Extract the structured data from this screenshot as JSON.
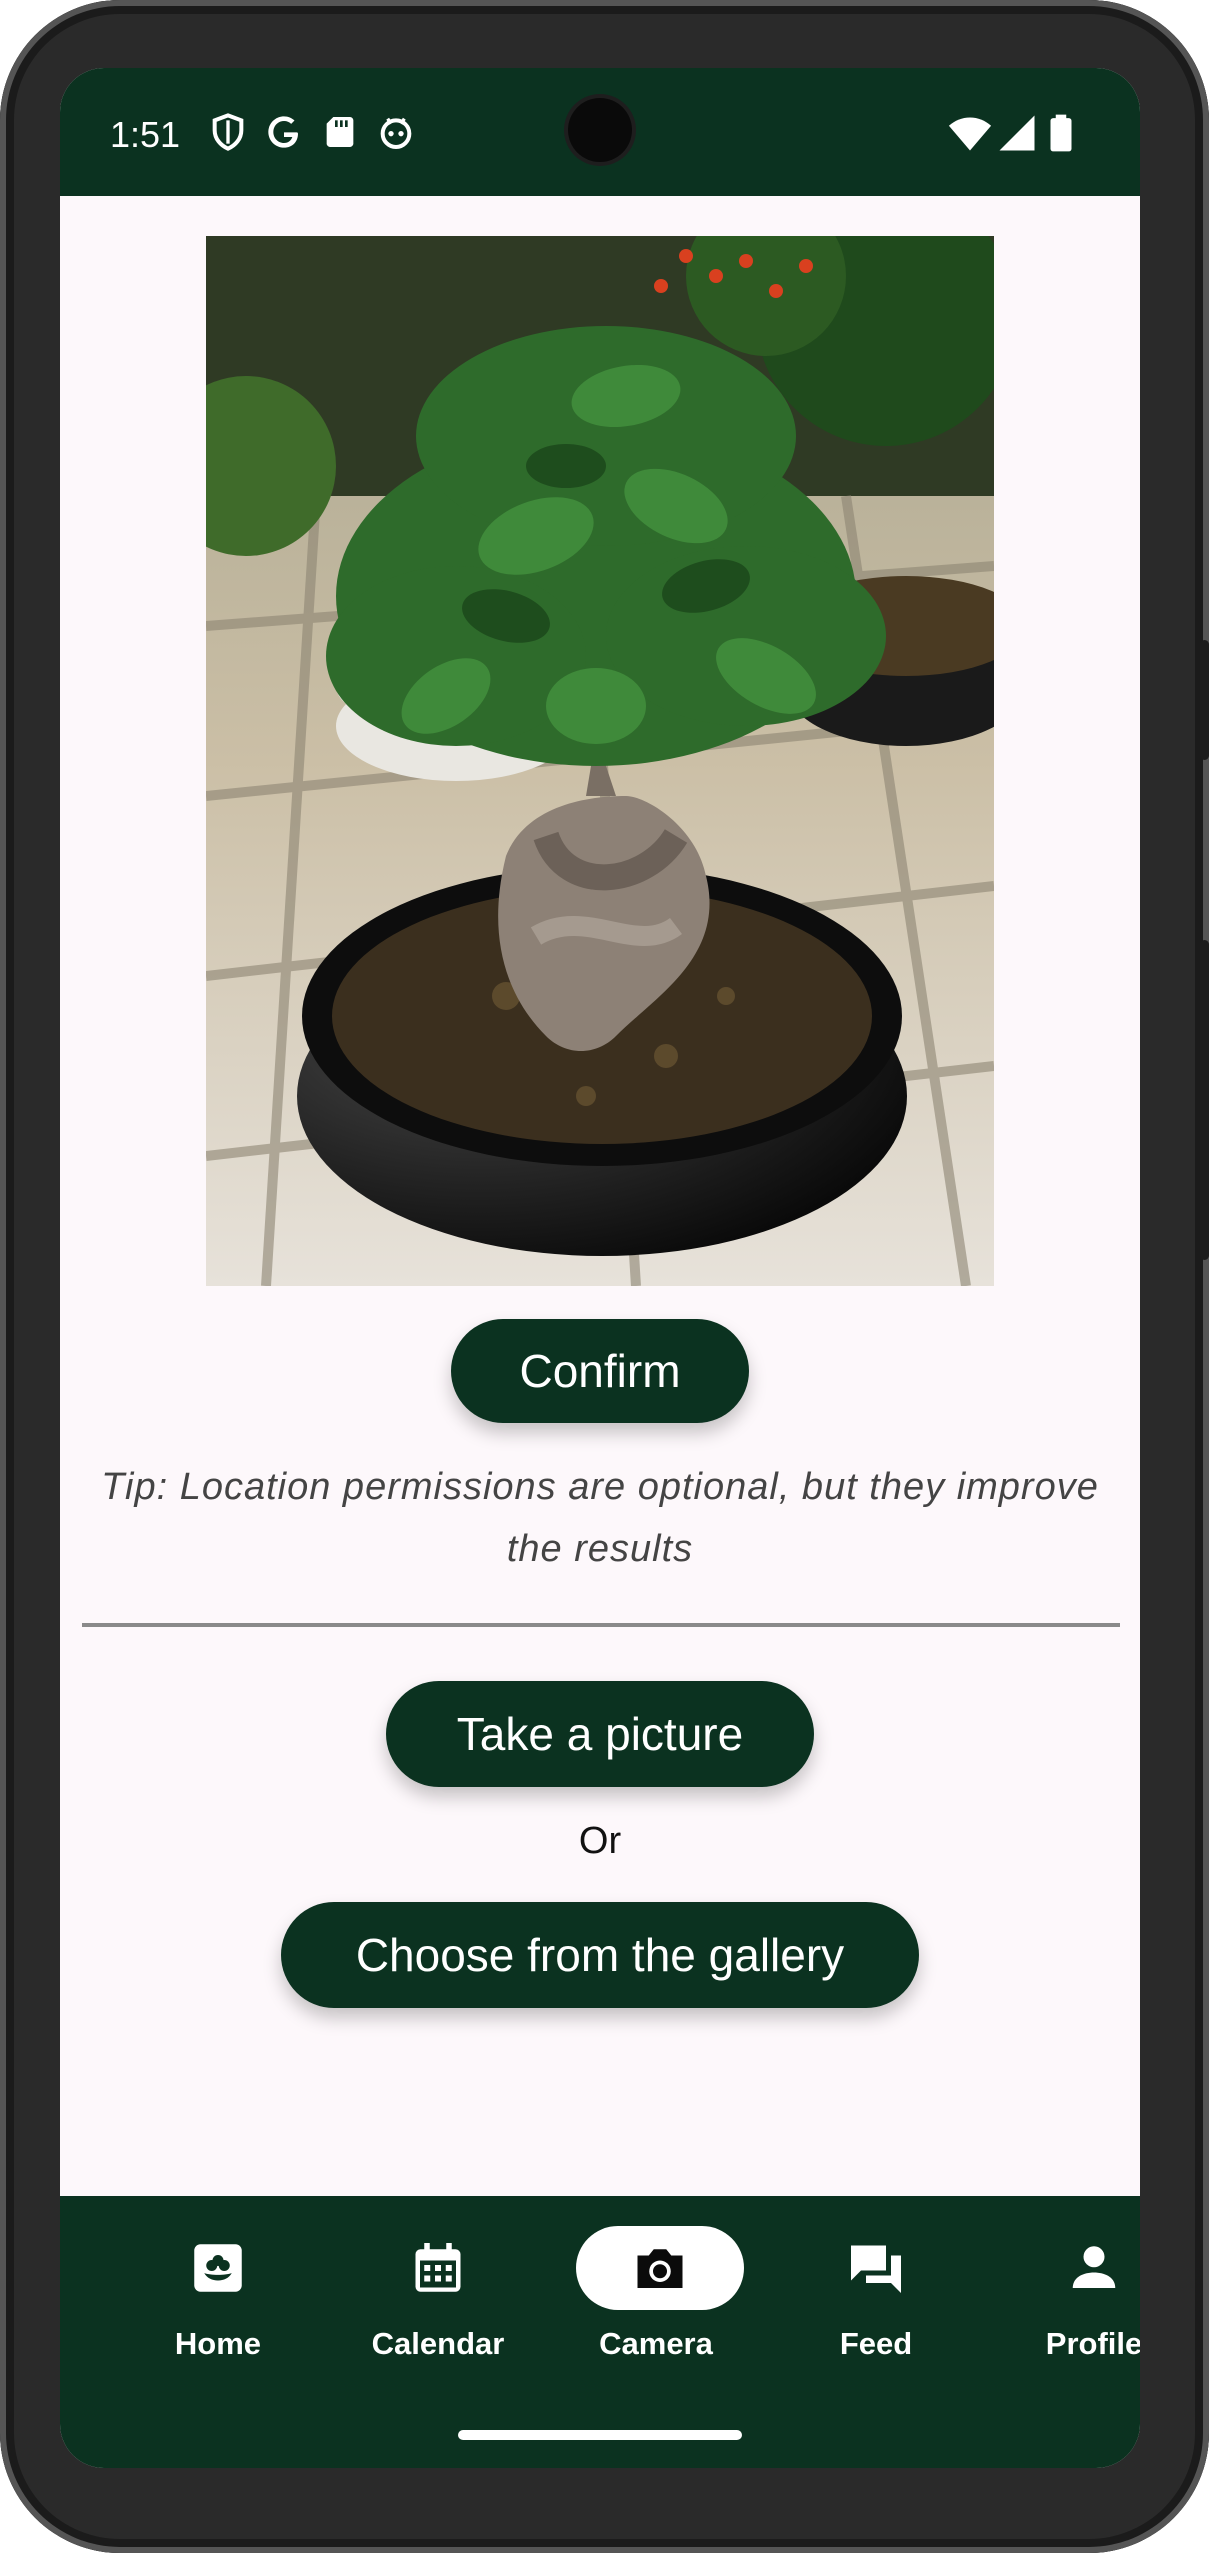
{
  "status_bar": {
    "time": "1:51",
    "left_icons": [
      "shield-icon",
      "google-icon",
      "sd-card-icon",
      "android-debug-icon"
    ],
    "right_icons": [
      "wifi-icon",
      "signal-icon",
      "battery-icon"
    ]
  },
  "main": {
    "photo": {
      "description": "bonsai-plant-photo",
      "icon": "plant-photo"
    },
    "confirm_label": "Confirm",
    "tip": "Tip: Location permissions are optional, but they improve the results",
    "take_picture_label": "Take a picture",
    "or_label": "Or",
    "gallery_label": "Choose from the gallery"
  },
  "nav": {
    "items": [
      {
        "label": "Home",
        "icon": "home-plant-icon",
        "active": false
      },
      {
        "label": "Calendar",
        "icon": "calendar-icon",
        "active": false
      },
      {
        "label": "Camera",
        "icon": "camera-icon",
        "active": true
      },
      {
        "label": "Feed",
        "icon": "chat-icon",
        "active": false
      },
      {
        "label": "Profile",
        "icon": "person-icon",
        "active": false
      }
    ]
  },
  "colors": {
    "primary": "#0b3220",
    "background": "#fdf8fb",
    "on_primary": "#ffffff",
    "nav_active_pill": "#ffffff"
  }
}
